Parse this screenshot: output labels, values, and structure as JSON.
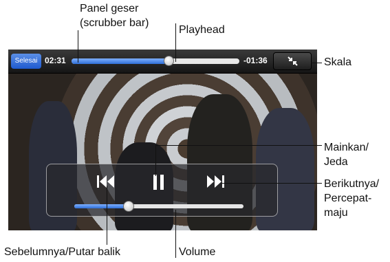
{
  "player": {
    "done_label": "Selesai",
    "elapsed": "02:31",
    "remaining": "-01:36",
    "progress": 0.58,
    "volume": 0.32
  },
  "annotations": {
    "scrubber_line1": "Panel geser",
    "scrubber_line2": "(scrubber bar)",
    "playhead": "Playhead",
    "scale": "Skala",
    "playpause_line1": "Mainkan/",
    "playpause_line2": "Jeda",
    "next_line1": "Berikutnya/",
    "next_line2": "Percepat-",
    "next_line3": "maju",
    "previous": "Sebelumnya/Putar balik",
    "volume": "Volume"
  },
  "icons": {
    "previous": "previous-icon",
    "pause": "pause-icon",
    "next": "next-icon",
    "scale": "scale-icon"
  },
  "colors": {
    "done_button": "#2f6fd8",
    "progress_fill": "#2f6fd8"
  }
}
